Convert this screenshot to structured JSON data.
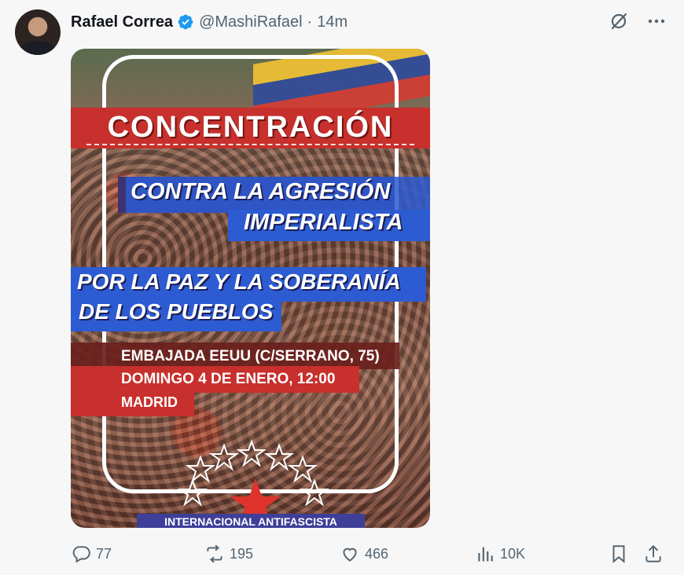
{
  "tweet": {
    "author_name": "Rafael Correa",
    "handle": "@MashiRafael",
    "separator": "·",
    "time": "14m"
  },
  "icons": {
    "verified": "verified-badge-icon",
    "grok": "grok-icon",
    "more": "more-icon"
  },
  "poster": {
    "headline": "CONCENTRACIÓN",
    "line1": "CONTRA LA AGRESIÓN",
    "line2": "IMPERIALISTA",
    "line3": "POR LA PAZ Y LA SOBERANÍA",
    "line4": "DE LOS PUEBLOS",
    "location": "EMBAJADA EEUU (C/SERRANO, 75)",
    "date": "DOMINGO 4 DE ENERO, 12:00",
    "city": "MADRID",
    "footer": "INTERNACIONAL ANTIFASCISTA"
  },
  "actions": {
    "replies": "77",
    "reposts": "195",
    "likes": "466",
    "views": "10K"
  },
  "colors": {
    "accent_blue": "#1d9bf0",
    "text_muted": "#536471",
    "poster_red": "#c7302c",
    "poster_blue": "#2d5bd2"
  }
}
